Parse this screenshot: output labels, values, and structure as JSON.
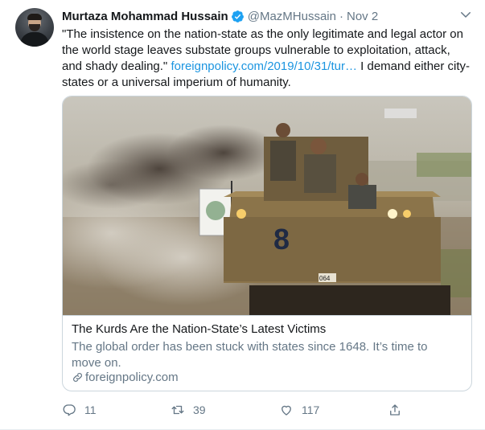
{
  "tweet": {
    "author_name": "Murtaza Mohammad Hussain",
    "handle": "@MazMHussain",
    "separator": "·",
    "date": "Nov 2",
    "text_before_link": "\"The insistence on the nation-state as the only legitimate and legal actor on the world stage leaves substate groups vulnerable to exploitation, attack, and shady dealing.\"",
    "link_text": "foreignpolicy.com/2019/10/31/tur…",
    "text_after_link": "I demand either city-states or a universal imperium of humanity."
  },
  "card": {
    "title": "The Kurds Are the Nation-State’s Latest Victims",
    "description": "The global order has been stuck with states since 1648. It’s time to move on.",
    "domain": "foreignpolicy.com",
    "image_text": {
      "hull_number": "8",
      "plate": "064"
    }
  },
  "actions": {
    "reply_count": "11",
    "retweet_count": "39",
    "like_count": "117"
  },
  "colors": {
    "link": "#1b95e0",
    "muted": "#657786",
    "verified": "#1da1f2",
    "border": "#ccd6dd"
  },
  "icons": [
    "verified-badge-icon",
    "chevron-down-icon",
    "link-icon",
    "reply-icon",
    "retweet-icon",
    "like-icon",
    "share-icon"
  ]
}
